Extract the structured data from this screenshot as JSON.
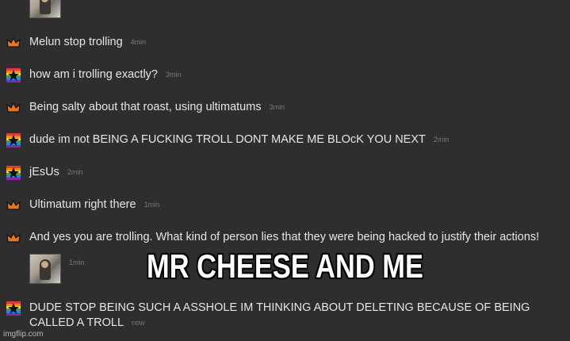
{
  "messages": [
    {
      "type": "image",
      "time": ""
    },
    {
      "type": "text",
      "user": "crown",
      "text": "Melun stop trolling",
      "time": "4min"
    },
    {
      "type": "text",
      "user": "star",
      "text": "how am i trolling exactly?",
      "time": "3min"
    },
    {
      "type": "text",
      "user": "crown",
      "text": "Being salty about that roast, using ultimatums",
      "time": "3min"
    },
    {
      "type": "text",
      "user": "star",
      "text": "dude im not BEING A FUCKING TROLL DONT MAKE ME BLOcK YOU NEXT",
      "time": "2min"
    },
    {
      "type": "text",
      "user": "star",
      "text": "jEsUs",
      "time": "2min"
    },
    {
      "type": "text",
      "user": "crown",
      "text": "Ultimatum right there",
      "time": "1min"
    },
    {
      "type": "text",
      "user": "crown",
      "text": "And yes you are trolling. What kind of person lies that they were being hacked to justify their actions!",
      "time": ""
    },
    {
      "type": "image",
      "time": "1min"
    },
    {
      "type": "text",
      "user": "star",
      "text": "DUDE STOP BEING SUCH A ASSHOLE IM THINKING ABOUT DELETING BECAUSE OF BEING CALLED A TROLL",
      "time": "now"
    }
  ],
  "caption": "MR CHEESE AND ME",
  "watermark": "imgflip.com",
  "icons": {
    "crown": "crown-icon",
    "star": "rainbow-star-icon"
  },
  "colors": {
    "background": "#2e2e2e",
    "text": "#e6e6e6",
    "time": "#7a7a7a"
  }
}
